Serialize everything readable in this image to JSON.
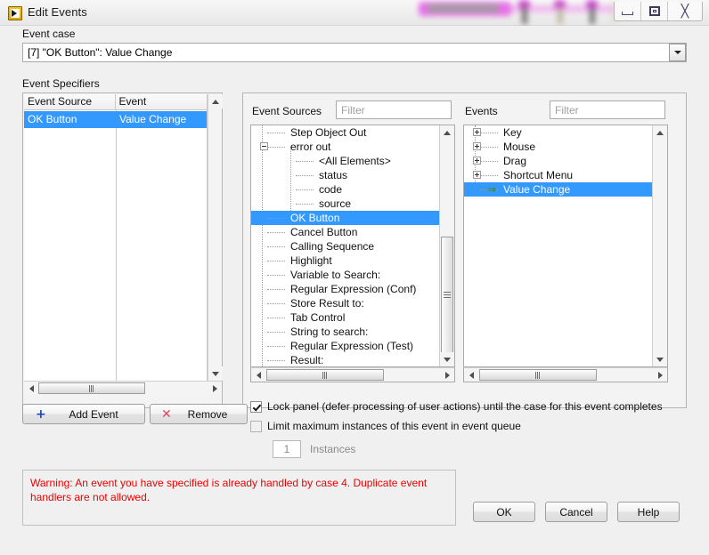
{
  "window": {
    "title": "Edit Events",
    "icon": "labview-icon",
    "controls": {
      "minimize": "minimize-icon",
      "maximize": "maximize-icon",
      "close": "close-icon"
    }
  },
  "event_case": {
    "label": "Event case",
    "value": "[7] \"OK Button\": Value Change",
    "dropdown_icon": "chevron-down-icon"
  },
  "event_specifiers": {
    "label": "Event Specifiers",
    "columns": [
      "Event Source",
      "Event"
    ],
    "rows": [
      {
        "source": "OK Button",
        "event": "Value Change",
        "selected": true
      }
    ]
  },
  "event_sources": {
    "label": "Event Sources",
    "filter_placeholder": "Filter",
    "filter_value": "",
    "nodes": [
      {
        "label": "Step Object Out",
        "depth": 1,
        "expander": "none",
        "selected": false
      },
      {
        "label": "error out",
        "depth": 1,
        "expander": "minus",
        "selected": false
      },
      {
        "label": "<All Elements>",
        "depth": 2,
        "expander": "none",
        "selected": false
      },
      {
        "label": "status",
        "depth": 2,
        "expander": "none",
        "selected": false
      },
      {
        "label": "code",
        "depth": 2,
        "expander": "none",
        "selected": false
      },
      {
        "label": "source",
        "depth": 2,
        "expander": "none",
        "selected": false
      },
      {
        "label": "OK Button",
        "depth": 1,
        "expander": "none",
        "selected": true
      },
      {
        "label": "Cancel Button",
        "depth": 1,
        "expander": "none",
        "selected": false
      },
      {
        "label": "Calling Sequence",
        "depth": 1,
        "expander": "none",
        "selected": false
      },
      {
        "label": "Highlight",
        "depth": 1,
        "expander": "none",
        "selected": false
      },
      {
        "label": "Variable to Search:",
        "depth": 1,
        "expander": "none",
        "selected": false
      },
      {
        "label": "Regular Expression (Conf)",
        "depth": 1,
        "expander": "none",
        "selected": false
      },
      {
        "label": "Store Result to:",
        "depth": 1,
        "expander": "none",
        "selected": false
      },
      {
        "label": "Tab Control",
        "depth": 1,
        "expander": "none",
        "selected": false
      },
      {
        "label": "String to search:",
        "depth": 1,
        "expander": "none",
        "selected": false
      },
      {
        "label": "Regular Expression (Test)",
        "depth": 1,
        "expander": "none",
        "selected": false
      },
      {
        "label": "Result:",
        "depth": 1,
        "expander": "none",
        "selected": false
      }
    ]
  },
  "events": {
    "label": "Events",
    "filter_placeholder": "Filter",
    "filter_value": "",
    "nodes": [
      {
        "label": "Key",
        "depth": 1,
        "expander": "plus",
        "selected": false,
        "marker": "none"
      },
      {
        "label": "Mouse",
        "depth": 1,
        "expander": "plus",
        "selected": false,
        "marker": "none"
      },
      {
        "label": "Drag",
        "depth": 1,
        "expander": "plus",
        "selected": false,
        "marker": "none"
      },
      {
        "label": "Shortcut Menu",
        "depth": 1,
        "expander": "plus",
        "selected": false,
        "marker": "none"
      },
      {
        "label": "Value Change",
        "depth": 1,
        "expander": "none",
        "selected": true,
        "marker": "green-arrow"
      }
    ]
  },
  "actions": {
    "add_event": "Add Event",
    "add_event_icon": "plus-icon",
    "remove": "Remove",
    "remove_icon": "x-icon"
  },
  "options": {
    "lock_panel": {
      "label": "Lock panel (defer processing of user actions) until the case for this event completes",
      "checked": true,
      "enabled": true
    },
    "limit_instances": {
      "label": "Limit maximum instances of this event in event queue",
      "checked": false,
      "enabled": true
    },
    "instances": {
      "value": "1",
      "label": "Instances",
      "enabled": false
    }
  },
  "warning": {
    "text": "Warning:  An event you have specified is already handled by case 4. Duplicate event handlers are not allowed.",
    "color": "#ee0000"
  },
  "footer": {
    "ok": "OK",
    "cancel": "Cancel",
    "help": "Help"
  },
  "colors": {
    "selection": "#3399ff",
    "dialog_bg": "#f0f0f0",
    "warning_text": "#ee0000",
    "title_icon": "#f9c21a"
  }
}
